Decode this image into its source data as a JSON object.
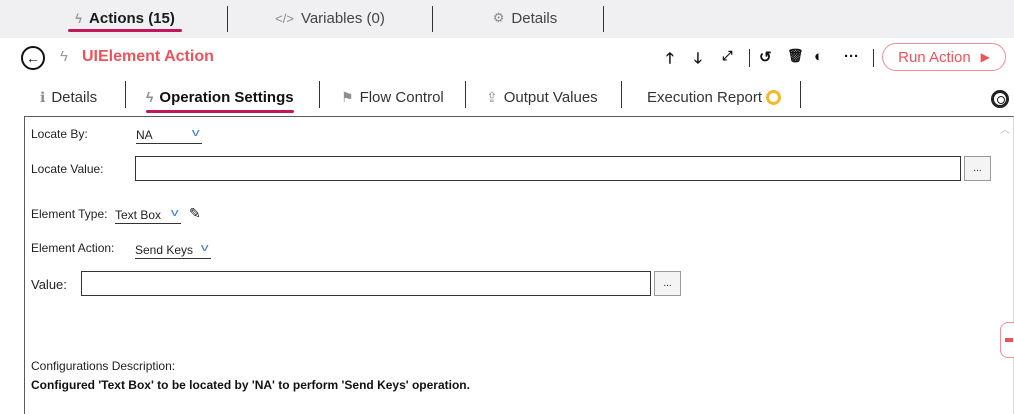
{
  "top_tabs": [
    {
      "label": "Actions (15)",
      "icon": "bolt-icon"
    },
    {
      "label": "Variables (0)",
      "icon": "code-icon"
    },
    {
      "label": "Details",
      "icon": "gear-icon"
    }
  ],
  "header": {
    "title": "UIElement Action",
    "run_label": "Run Action"
  },
  "inner_tabs": [
    {
      "label": "Details"
    },
    {
      "label": "Operation Settings"
    },
    {
      "label": "Flow Control"
    },
    {
      "label": "Output Values"
    },
    {
      "label": "Execution Report"
    }
  ],
  "form": {
    "locate_by_label": "Locate By:",
    "locate_by_value": "NA",
    "locate_value_label": "Locate Value:",
    "locate_value": "",
    "browse_label": "...",
    "element_type_label": "Element Type:",
    "element_type_value": "Text Box",
    "element_action_label": "Element Action:",
    "element_action_value": "Send Keys",
    "value_label": "Value:",
    "value": "",
    "config_desc_label": "Configurations Description:",
    "config_desc_text": "Configured 'Text Box' to be located by 'NA' to perform 'Send Keys' operation."
  },
  "colors": {
    "accent": "#c2185b",
    "title": "#e8555c",
    "dropdown_chevron": "#3a7bd5"
  }
}
